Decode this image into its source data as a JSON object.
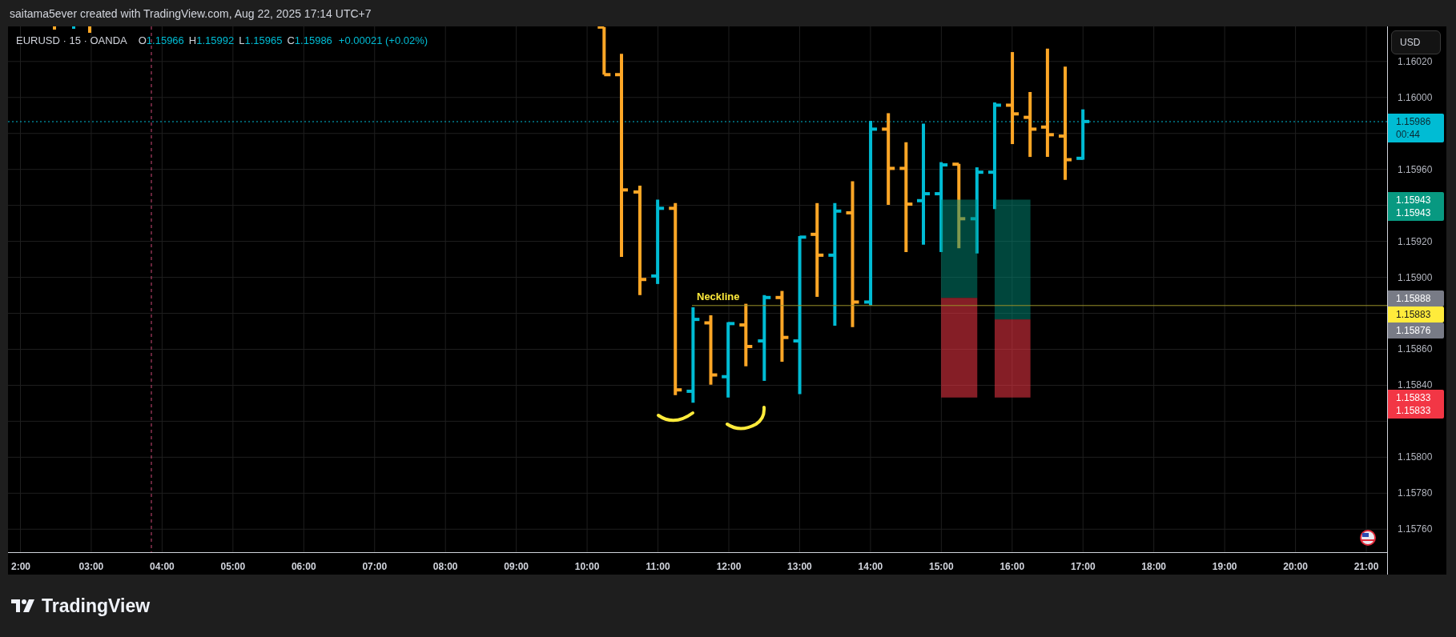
{
  "header": {
    "text": "saitama5ever created with TradingView.com, Aug 22, 2025 17:14 UTC+7"
  },
  "legend": {
    "symbol": "EURUSD · 15 · OANDA",
    "values": [
      {
        "label": "O",
        "value": "1.15966"
      },
      {
        "label": "H",
        "value": "1.15992"
      },
      {
        "label": "L",
        "value": "1.15965"
      },
      {
        "label": "C",
        "value": "1.15986"
      }
    ],
    "change": "+0.00021 (+0.02%)"
  },
  "neckline": {
    "label": "Neckline"
  },
  "currency_button": {
    "label": "USD"
  },
  "price_axis": {
    "ticks": [
      "1.16020",
      "1.16000",
      "1.15960",
      "1.15920",
      "1.15900",
      "1.15860",
      "1.15840",
      "1.15800",
      "1.15780",
      "1.15760"
    ]
  },
  "price_labels": [
    {
      "kind": "last",
      "lines": [
        "1.15986",
        "00:44"
      ],
      "color": "#00bcd4"
    },
    {
      "kind": "target",
      "lines": [
        "1.15943",
        "1.15943"
      ],
      "color": "#089981"
    },
    {
      "kind": "level",
      "lines": [
        "1.15888"
      ],
      "color": "#787b86"
    },
    {
      "kind": "line",
      "lines": [
        "1.15883"
      ],
      "color": "#ffeb3b"
    },
    {
      "kind": "level",
      "lines": [
        "1.15876"
      ],
      "color": "#787b86"
    },
    {
      "kind": "stop",
      "lines": [
        "1.15833",
        "1.15833"
      ],
      "color": "#f23645"
    }
  ],
  "time_axis": {
    "ticks": [
      "2:00",
      "03:00",
      "04:00",
      "05:00",
      "06:00",
      "07:00",
      "08:00",
      "09:00",
      "10:00",
      "11:00",
      "12:00",
      "13:00",
      "14:00",
      "15:00",
      "16:00",
      "17:00",
      "18:00",
      "19:00",
      "20:00",
      "21:00"
    ]
  },
  "footer": {
    "brand": "TradingView"
  }
}
